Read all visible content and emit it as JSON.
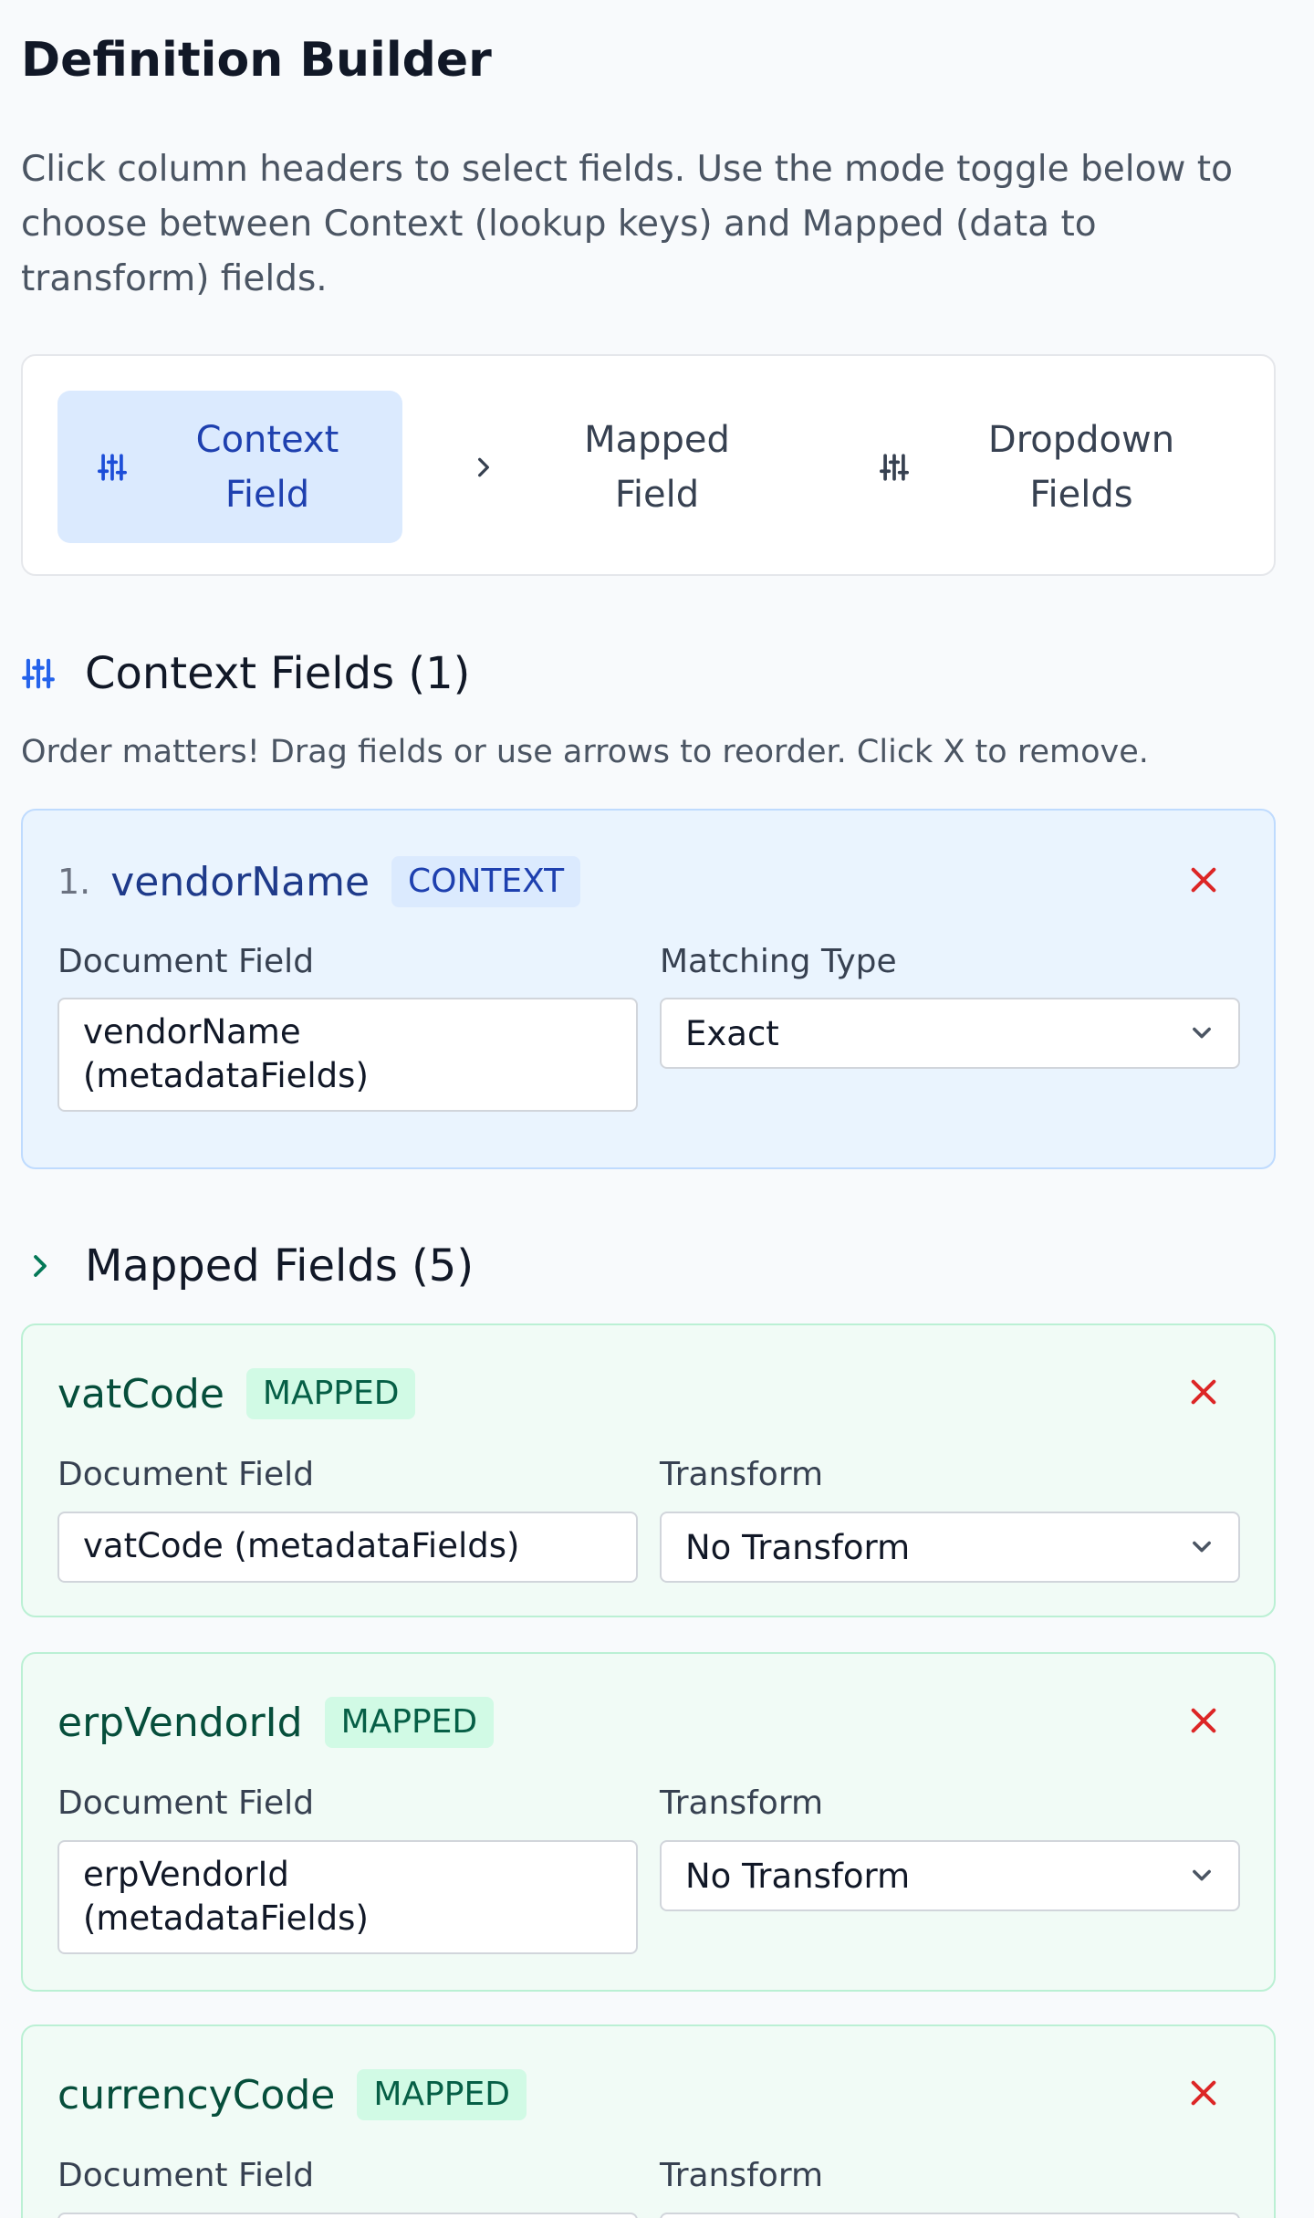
{
  "page_title": "Definition Builder",
  "description": "Click column headers to select fields. Use the mode toggle below to choose between Context (lookup keys) and Mapped (data to transform) fields.",
  "mode_toggle": {
    "context_line1": "Context",
    "context_line2": "Field",
    "mapped_line1": "Mapped",
    "mapped_line2": "Field",
    "dropdown_line1": "Dropdown",
    "dropdown_line2": "Fields",
    "active": "context"
  },
  "context_section": {
    "title": "Context Fields (1)",
    "hint": "Order matters! Drag fields or use arrows to reorder. Click X to remove.",
    "items": [
      {
        "index": "1.",
        "name": "vendorName",
        "badge": "CONTEXT",
        "doc_field_label": "Document Field",
        "doc_field_line1": "vendorName",
        "doc_field_line2": "(metadataFields)",
        "matching_label": "Matching Type",
        "matching_value": "Exact"
      }
    ]
  },
  "mapped_section": {
    "title": "Mapped Fields (5)",
    "items": [
      {
        "name": "vatCode",
        "badge": "MAPPED",
        "doc_field_label": "Document Field",
        "doc_field_line1": "vatCode (metadataFields)",
        "doc_field_line2": "",
        "transform_label": "Transform",
        "transform_value": "No Transform"
      },
      {
        "name": "erpVendorId",
        "badge": "MAPPED",
        "doc_field_label": "Document Field",
        "doc_field_line1": "erpVendorId",
        "doc_field_line2": "(metadataFields)",
        "transform_label": "Transform",
        "transform_value": "No Transform"
      },
      {
        "name": "currencyCode",
        "badge": "MAPPED",
        "doc_field_label": "Document Field",
        "transform_label": "Transform"
      }
    ]
  },
  "colors": {
    "accent_blue": "#2563eb",
    "accent_green": "#047857",
    "remove_red": "#dc2626"
  },
  "icons": {
    "context": "sliders-icon",
    "mapped": "chevron-right-icon",
    "dropdown": "sliders-icon",
    "remove": "close-icon",
    "select": "chevron-down-icon"
  }
}
